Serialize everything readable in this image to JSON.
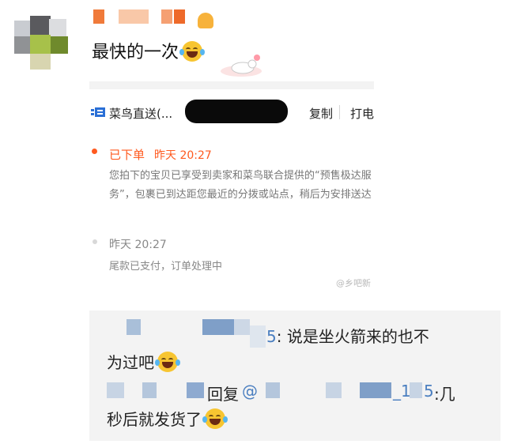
{
  "post": {
    "message": "最快的一次",
    "emoji": "laughing-with-tears"
  },
  "order_screenshot": {
    "courier": "菜鸟直送(...",
    "copy_label": "复制",
    "call_label": "打电",
    "status": "已下单",
    "status_time": "昨天 20:27",
    "status_detail": "您拍下的宝贝已享受到卖家和菜鸟联合提供的“预售极达服务”，包裹已到达距您最近的分拨或站点，稍后为安排送达",
    "history_time": "昨天 20:27",
    "history_detail": "尾款已支付，订单处理中",
    "accent_color": "#ff5a1f"
  },
  "watermark": "@乡吧新",
  "comments": [
    {
      "suffix": "5",
      "line1": ": 说是坐火箭来的也不",
      "line2": "为过吧"
    },
    {
      "reply_label": "回复",
      "mention": "@",
      "mention_tail": "_1",
      "suffix": "5",
      "line1": ":几",
      "line2": "秒后就发货了"
    }
  ]
}
